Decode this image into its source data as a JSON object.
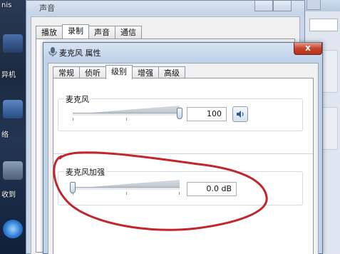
{
  "desktop": {
    "labels": [
      "nis",
      "异机",
      "络",
      "收到"
    ]
  },
  "back_window": {
    "title": "声音",
    "tabs": [
      "播放",
      "录制",
      "声音",
      "通信"
    ],
    "active_tab_index": 1
  },
  "front_window": {
    "title": "麦克风 属性",
    "close_label": "x",
    "tabs": [
      "常规",
      "侦听",
      "级别",
      "增强",
      "高级"
    ],
    "active_tab_index": 2,
    "microphone": {
      "label": "麦克风",
      "value": "100",
      "level": 1.0
    },
    "boost": {
      "label": "麦克风加强",
      "value": "0.0 dB",
      "level": 0.0
    }
  },
  "colors": {
    "annotation": "#c0262a",
    "close_button": "#c5432b",
    "titlebar": "#bfd1e8"
  }
}
